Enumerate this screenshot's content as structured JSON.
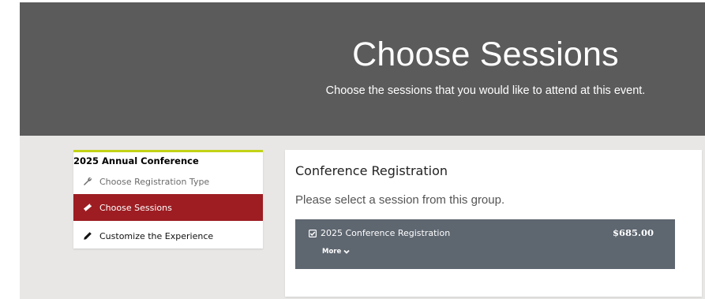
{
  "hero": {
    "title": "Choose Sessions",
    "subtitle": "Choose the sessions that you would like to attend at this event."
  },
  "sidebar": {
    "heading": "2025 Annual Conference",
    "items": [
      {
        "label": "Choose Registration Type",
        "icon": "wrench-icon",
        "state": "completed"
      },
      {
        "label": "Choose Sessions",
        "icon": "ticket-icon",
        "state": "active"
      },
      {
        "label": "Customize the Experience",
        "icon": "pencil-icon",
        "state": "upcoming"
      }
    ]
  },
  "panel": {
    "title": "Conference Registration",
    "instruction": "Please select a session from this group.",
    "session": {
      "name": "2025 Conference Registration",
      "price": "$685.00",
      "selected": true,
      "more_label": "More"
    }
  },
  "colors": {
    "hero_bg": "#5b5b5b",
    "page_bg": "#e8e7e6",
    "active_nav": "#9d1d22",
    "accent_border": "#c3d316",
    "session_bg": "#5e6670"
  }
}
